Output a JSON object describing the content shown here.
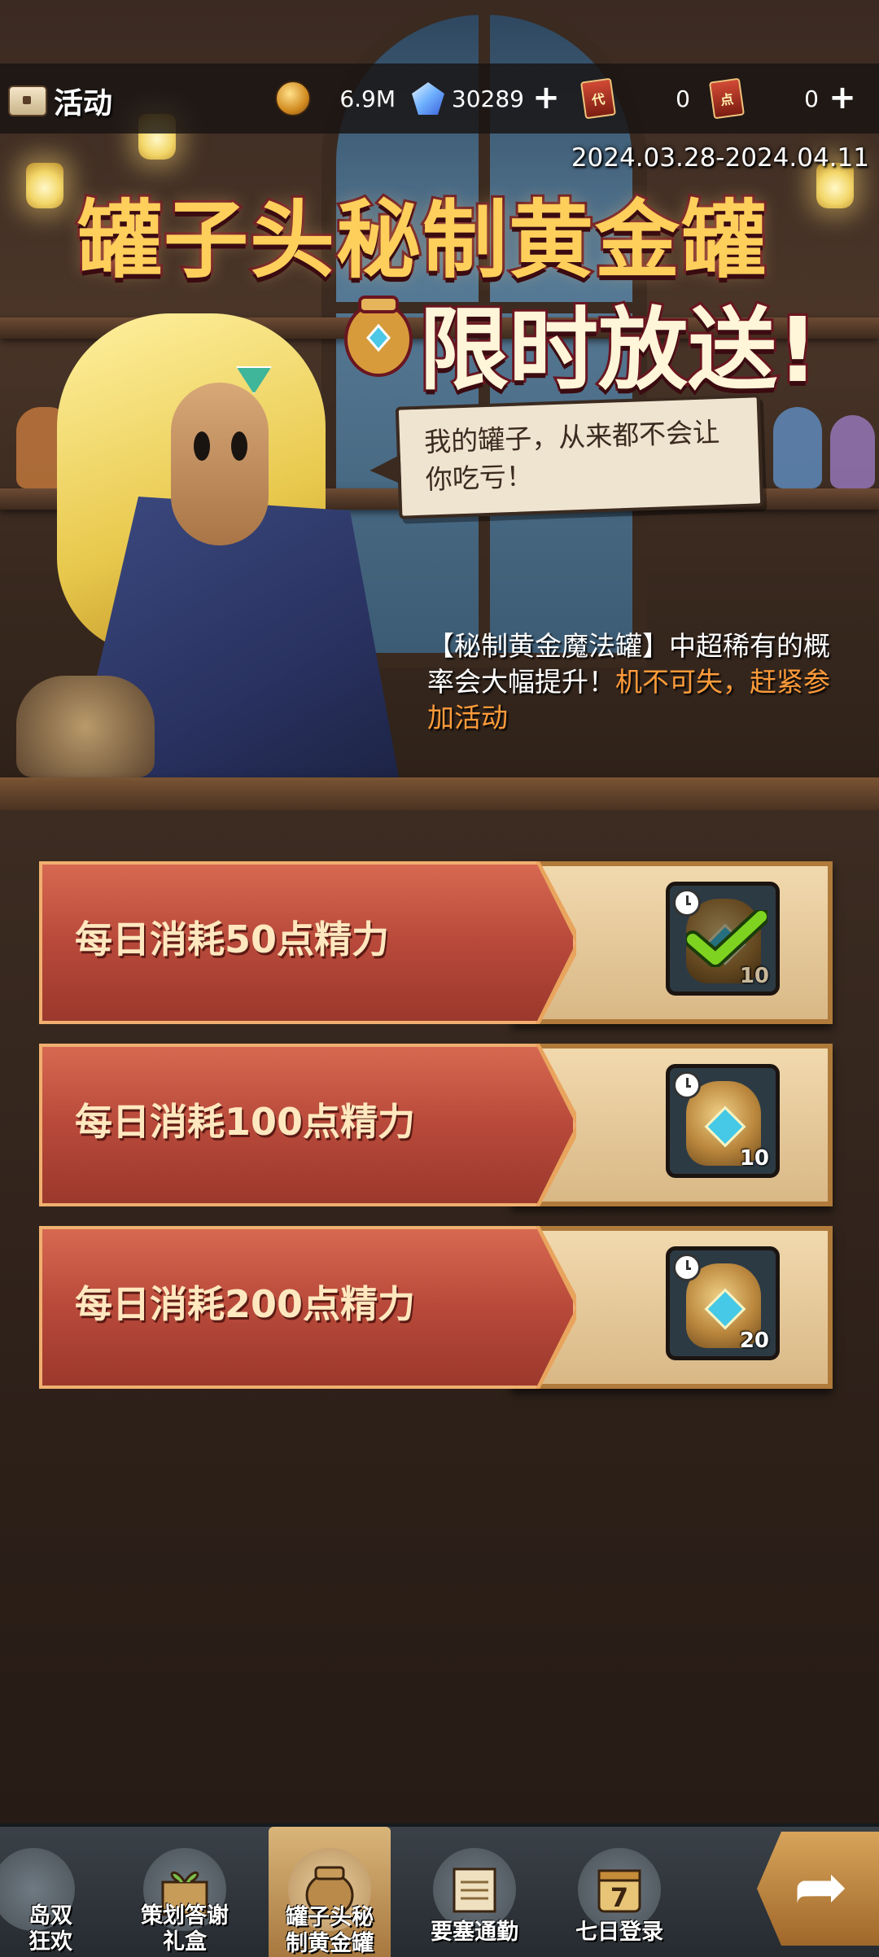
{
  "topbar": {
    "title": "活动",
    "resources": [
      {
        "name": "gold",
        "icon": "coin-icon",
        "value": "6.9M"
      },
      {
        "name": "crystal",
        "icon": "crystal-icon",
        "value": "30289"
      },
      {
        "name": "ticket-dai",
        "icon": "card-icon",
        "icon_char": "代",
        "value": "0"
      },
      {
        "name": "ticket-dian",
        "icon": "card-icon",
        "icon_char": "点",
        "value": "0"
      }
    ]
  },
  "banner": {
    "date_range": "2024.03.28-2024.04.11",
    "headline_line1": "罐子头秘制黄金罐",
    "headline_line2": "限时放送!",
    "speech": "我的罐子，从来都不会让你吃亏！",
    "info_normal": "【秘制黄金魔法罐】中超稀有的概率会大幅提升！",
    "info_highlight": "机不可失，赶紧参加活动"
  },
  "tasks": [
    {
      "label": "每日消耗50点精力",
      "reward_count": "10",
      "completed": true
    },
    {
      "label": "每日消耗100点精力",
      "reward_count": "10",
      "completed": false
    },
    {
      "label": "每日消耗200点精力",
      "reward_count": "20",
      "completed": false
    }
  ],
  "bottom_nav": {
    "tabs": [
      {
        "label_line1": "岛双",
        "label_line2": "狂欢",
        "active": false
      },
      {
        "label_line1": "策划答谢",
        "label_line2": "礼盒",
        "active": false
      },
      {
        "label_line1": "罐子头秘",
        "label_line2": "制黄金罐",
        "active": true
      },
      {
        "label_line1": "要塞通勤",
        "label_line2": "",
        "active": false
      },
      {
        "label_line1": "七日登录",
        "label_line2": "",
        "active": false
      }
    ],
    "calendar_day": "7"
  },
  "colors": {
    "highlight": "#ff9b3a",
    "task_red": "#b8493a",
    "reward_bg": "#f1d9ae",
    "check_green": "#7ed321"
  }
}
